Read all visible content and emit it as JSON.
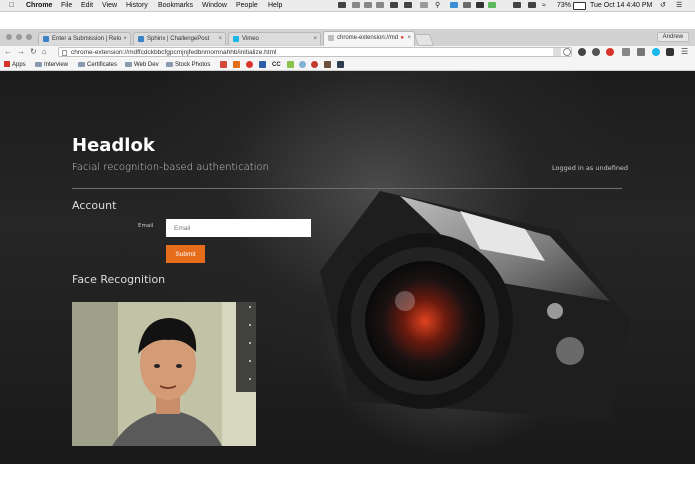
{
  "menubar": {
    "apple": "",
    "app": "Chrome",
    "items": [
      "File",
      "Edit",
      "View",
      "History",
      "Bookmarks",
      "Window",
      "People",
      "Help"
    ],
    "battery": "73%",
    "clock": "Tue Oct 14  4:40 PM"
  },
  "browser": {
    "tabs": [
      {
        "title": "Enter a Submission | Relo"
      },
      {
        "title": "Sphinx | ChallengePost"
      },
      {
        "title": "Vimeo"
      },
      {
        "title": "chrome-extension://md"
      }
    ],
    "profile": "Andrew",
    "url": "chrome-extension://mdffcdckbbcfgpcmjnjfedbnmomnahhb/initialize.html",
    "bookmarks": [
      "Apps",
      "Interview",
      "Certificates",
      "Web Dev",
      "Stock Photos",
      "CC"
    ]
  },
  "page": {
    "title": "Headlok",
    "subtitle": "Facial recognition-based authentication",
    "logged_in": "Logged in as undefined",
    "account_heading": "Account",
    "email_label": "Email",
    "email_placeholder": "Email",
    "submit_label": "Submit",
    "face_heading": "Face Recognition"
  },
  "colors": {
    "accent": "#e46c1a",
    "background": "#1c1c1c"
  }
}
